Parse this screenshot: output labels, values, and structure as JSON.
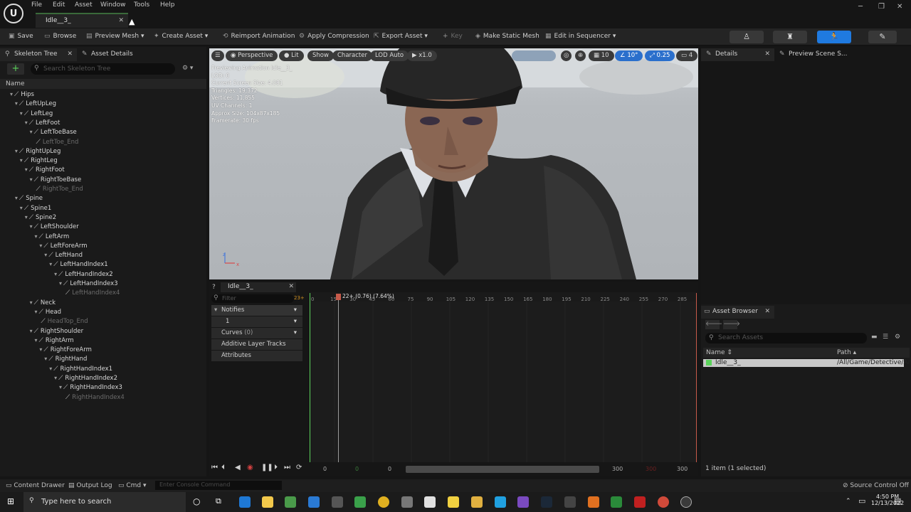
{
  "menu": [
    "File",
    "Edit",
    "Asset",
    "Window",
    "Tools",
    "Help"
  ],
  "document_tab": "Idle__3_",
  "toolbar": {
    "save": "Save",
    "browse": "Browse",
    "preview_mesh": "Preview Mesh",
    "create_asset": "Create Asset",
    "reimport": "Reimport Animation",
    "apply_compression": "Apply Compression",
    "export_asset": "Export Asset",
    "key": "Key",
    "make_static_mesh": "Make Static Mesh",
    "edit_in_sequencer": "Edit in Sequencer"
  },
  "left_panel": {
    "tab1": "Skeleton Tree",
    "tab2": "Asset Details",
    "search_placeholder": "Search Skeleton Tree",
    "column": "Name"
  },
  "bones": [
    {
      "name": "Hips",
      "depth": 0,
      "dim": false
    },
    {
      "name": "LeftUpLeg",
      "depth": 1,
      "dim": false
    },
    {
      "name": "LeftLeg",
      "depth": 2,
      "dim": false
    },
    {
      "name": "LeftFoot",
      "depth": 3,
      "dim": false
    },
    {
      "name": "LeftToeBase",
      "depth": 4,
      "dim": false
    },
    {
      "name": "LeftToe_End",
      "depth": 5,
      "dim": true
    },
    {
      "name": "RightUpLeg",
      "depth": 1,
      "dim": false
    },
    {
      "name": "RightLeg",
      "depth": 2,
      "dim": false
    },
    {
      "name": "RightFoot",
      "depth": 3,
      "dim": false
    },
    {
      "name": "RightToeBase",
      "depth": 4,
      "dim": false
    },
    {
      "name": "RightToe_End",
      "depth": 5,
      "dim": true
    },
    {
      "name": "Spine",
      "depth": 1,
      "dim": false
    },
    {
      "name": "Spine1",
      "depth": 2,
      "dim": false
    },
    {
      "name": "Spine2",
      "depth": 3,
      "dim": false
    },
    {
      "name": "LeftShoulder",
      "depth": 4,
      "dim": false
    },
    {
      "name": "LeftArm",
      "depth": 5,
      "dim": false
    },
    {
      "name": "LeftForeArm",
      "depth": 6,
      "dim": false
    },
    {
      "name": "LeftHand",
      "depth": 7,
      "dim": false
    },
    {
      "name": "LeftHandIndex1",
      "depth": 8,
      "dim": false
    },
    {
      "name": "LeftHandIndex2",
      "depth": 9,
      "dim": false
    },
    {
      "name": "LeftHandIndex3",
      "depth": 10,
      "dim": false
    },
    {
      "name": "LeftHandIndex4",
      "depth": 11,
      "dim": true
    },
    {
      "name": "Neck",
      "depth": 4,
      "dim": false
    },
    {
      "name": "Head",
      "depth": 5,
      "dim": false
    },
    {
      "name": "HeadTop_End",
      "depth": 6,
      "dim": true
    },
    {
      "name": "RightShoulder",
      "depth": 4,
      "dim": false
    },
    {
      "name": "RightArm",
      "depth": 5,
      "dim": false
    },
    {
      "name": "RightForeArm",
      "depth": 6,
      "dim": false
    },
    {
      "name": "RightHand",
      "depth": 7,
      "dim": false
    },
    {
      "name": "RightHandIndex1",
      "depth": 8,
      "dim": false
    },
    {
      "name": "RightHandIndex2",
      "depth": 9,
      "dim": false
    },
    {
      "name": "RightHandIndex3",
      "depth": 10,
      "dim": false
    },
    {
      "name": "RightHandIndex4",
      "depth": 11,
      "dim": true
    }
  ],
  "viewport": {
    "perspective": "Perspective",
    "lit": "Lit",
    "show": "Show",
    "character": "Character",
    "lod": "LOD Auto",
    "speed": "x1.0",
    "grid": "10",
    "angle": "10°",
    "scale": "0.25",
    "cams": "4",
    "stats": [
      "Previewing Animation Idle__3_",
      "LOD: 0",
      "Current Screen Size: 4.081",
      "Triangles: 19,372",
      "Vertices: 11,855",
      "UV Channels: 1",
      "Approx Size: 104x87x185",
      "Framerate: 30 fps"
    ]
  },
  "timeline": {
    "tab": "Idle__3_",
    "filter_placeholder": "Filter",
    "frame_badge": "23+",
    "playhead": "22+ (0.76) (7.64%)",
    "notifies": "Notifies",
    "notify_track": "1",
    "curves": "Curves",
    "curves_count": "(0)",
    "additive": "Additive Layer Tracks",
    "attributes": "Attributes",
    "ticks": [
      "0",
      "15",
      "30",
      "45",
      "60",
      "75",
      "90",
      "105",
      "120",
      "135",
      "150",
      "165",
      "180",
      "195",
      "210",
      "225",
      "240",
      "255",
      "270",
      "285"
    ],
    "start_val": "0",
    "mid_val": "0",
    "range_start": "0",
    "range_end": "300",
    "end_val": "300"
  },
  "right_panel": {
    "tab1": "Details",
    "tab2": "Preview Scene S...",
    "asset_browser": "Asset Browser",
    "search_placeholder": "Search Assets",
    "col_name": "Name",
    "col_path": "Path",
    "asset_name": "Idle__3_",
    "asset_path": "/All/Game/Detective/An",
    "count": "1 item (1 selected)"
  },
  "statusbar": {
    "content_drawer": "Content Drawer",
    "output_log": "Output Log",
    "cmd": "Cmd",
    "console_placeholder": "Enter Console Command",
    "source_control": "Source Control Off"
  },
  "taskbar": {
    "search_placeholder": "Type here to search",
    "time": "4:50 PM",
    "date": "12/13/2022"
  },
  "colors": {
    "accent_blue": "#1f7ae0",
    "track_green": "#5bd35b",
    "playhead": "#c75a4a"
  }
}
